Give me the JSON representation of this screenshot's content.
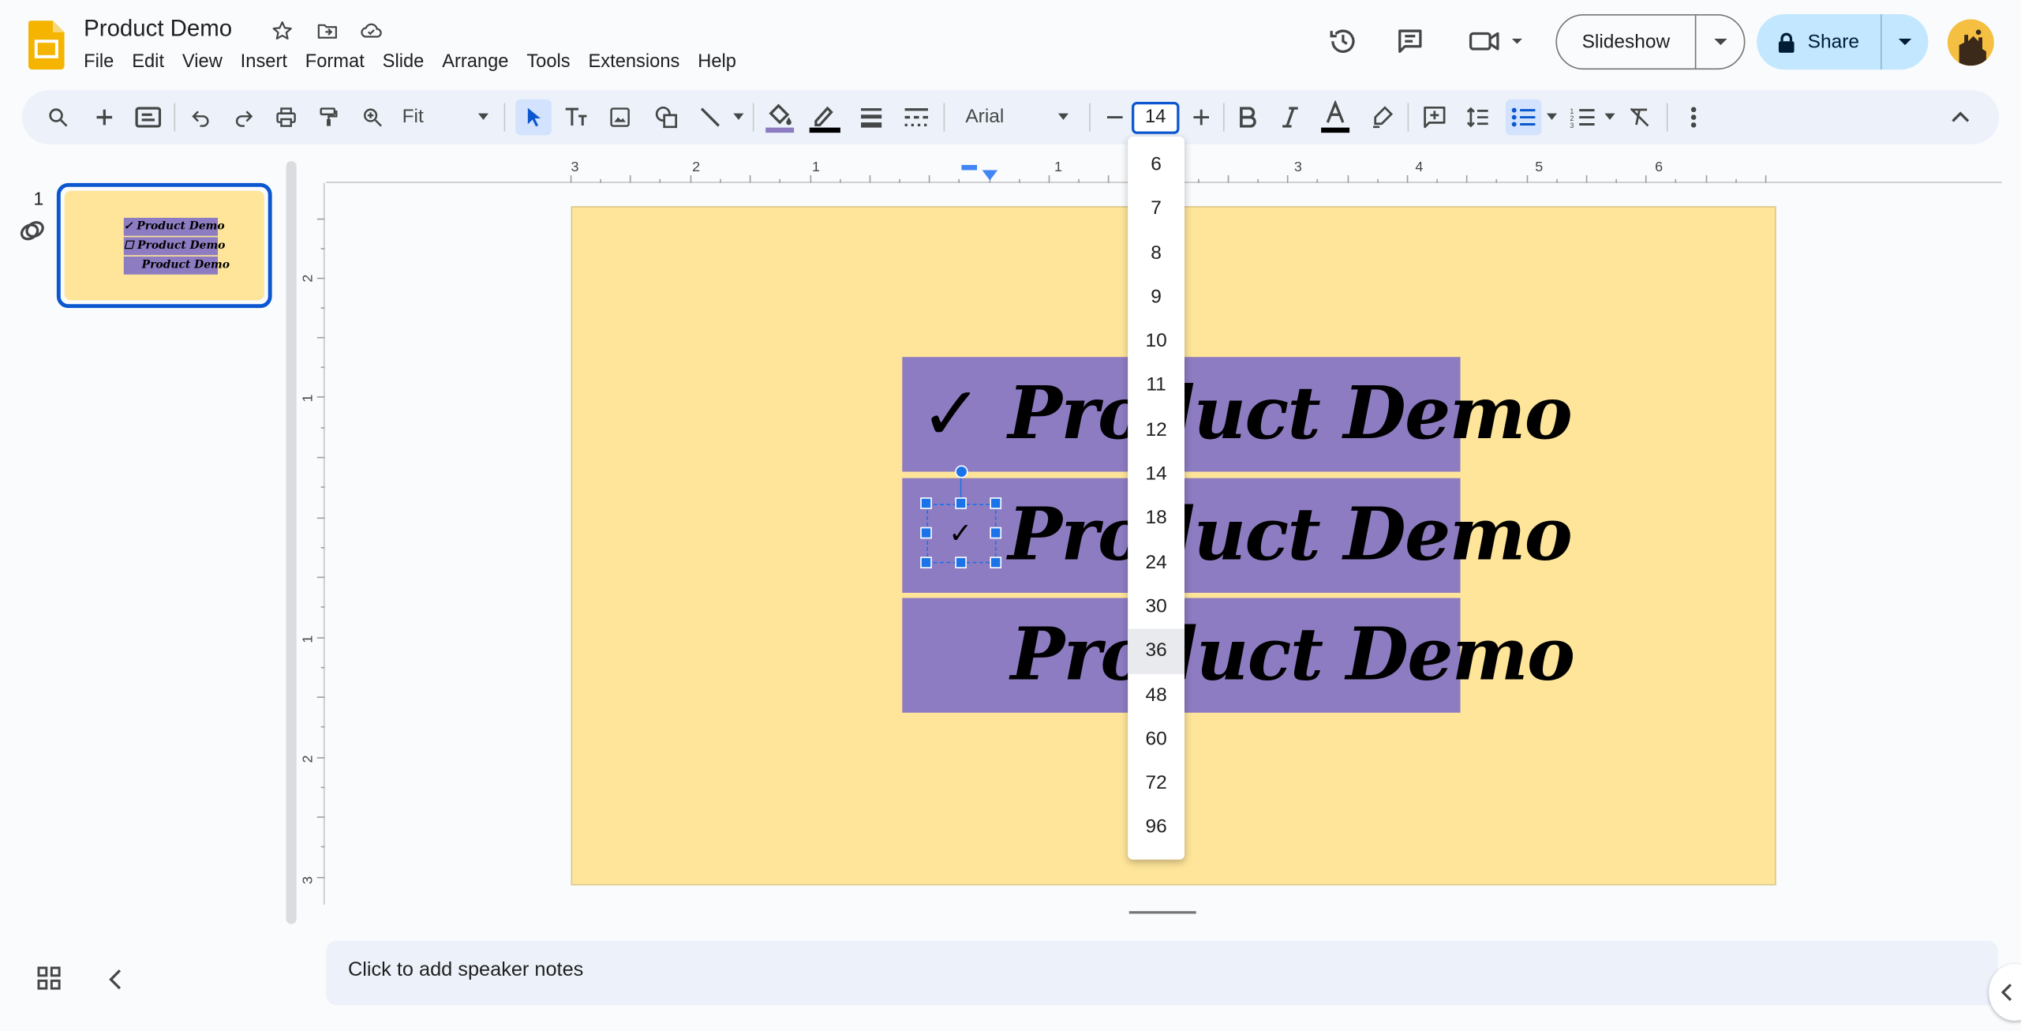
{
  "app": {
    "title": "Product Demo",
    "menu": [
      "File",
      "Edit",
      "View",
      "Insert",
      "Format",
      "Slide",
      "Arrange",
      "Tools",
      "Extensions",
      "Help"
    ],
    "slideshow_label": "Slideshow",
    "share_label": "Share"
  },
  "toolbar": {
    "zoom": "Fit",
    "font": "Arial",
    "font_size": "14",
    "fill_color": "#8e7cc3",
    "border_color": "#000000",
    "text_color": "#000000"
  },
  "font_size_menu": {
    "options": [
      "6",
      "7",
      "8",
      "9",
      "10",
      "11",
      "12",
      "14",
      "18",
      "24",
      "30",
      "36",
      "48",
      "60",
      "72",
      "96"
    ],
    "highlighted": "36"
  },
  "filmstrip": {
    "slide_number": "1",
    "thumb_lines": [
      "✓ Product Demo",
      "☐ Product Demo",
      "Product Demo"
    ]
  },
  "ruler": {
    "h_labels": [
      "3",
      "2",
      "1",
      "1",
      "2",
      "3",
      "4",
      "5",
      "6"
    ],
    "v_labels": [
      "2",
      "1",
      "1",
      "2",
      "3"
    ]
  },
  "slide": {
    "background": "#fee599",
    "band_color": "#8e7cc3",
    "bands": [
      {
        "check": "✓",
        "text": "Product Demo"
      },
      {
        "check": "",
        "text": "Product Demo"
      },
      {
        "check": "",
        "text": "Product Demo"
      }
    ],
    "selected_checkbox": "✓"
  },
  "notes": {
    "placeholder": "Click to add speaker notes"
  }
}
